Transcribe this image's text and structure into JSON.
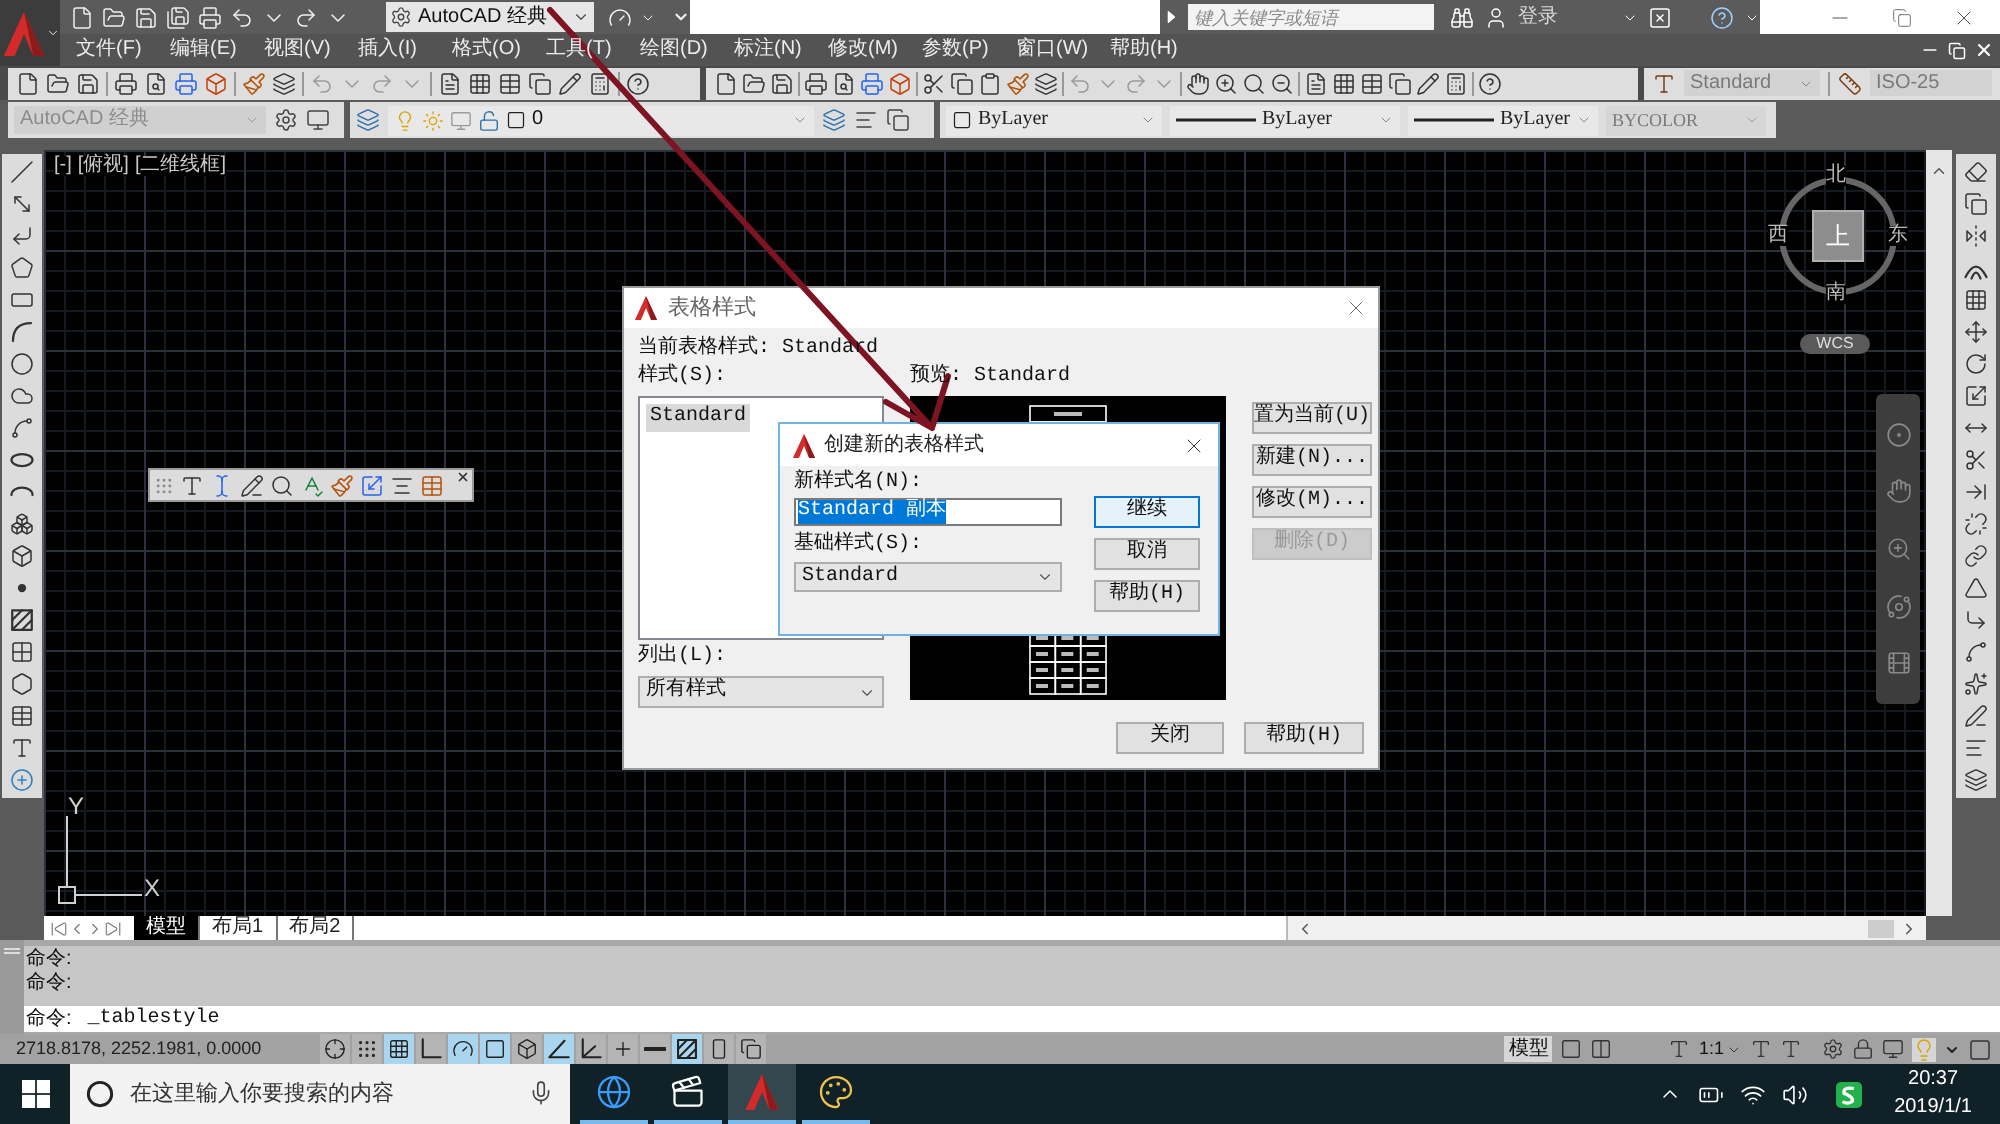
{
  "title_bar": {
    "workspace": "AutoCAD 经典",
    "search": {
      "placeholder": "键入关键字或短语"
    },
    "sign_in": "登录"
  },
  "menu_bar": {
    "items": [
      "文件(F)",
      "编辑(E)",
      "视图(V)",
      "插入(I)",
      "格式(O)",
      "工具(T)",
      "绘图(D)",
      "标注(N)",
      "修改(M)",
      "参数(P)",
      "窗口(W)",
      "帮助(H)"
    ]
  },
  "styles_toolbar": {
    "text_style": "Standard",
    "dimension_style": "ISO-25"
  },
  "properties_toolbar": {
    "workspace": "AutoCAD 经典",
    "layer": "0",
    "swatch_setting": "ByLayer",
    "linetype": "ByLayer",
    "lineweight": "ByLayer",
    "plot_style": "BYCOLOR"
  },
  "viewport": {
    "controls": [
      "[-]",
      "[俯视]",
      "[二维线框]"
    ]
  },
  "viewcube": {
    "north": "北",
    "west": "西",
    "top": "上",
    "east": "东",
    "south": "南",
    "ucs": "WCS"
  },
  "ucs_icon": {
    "y_label": "Y",
    "x_label": "X"
  },
  "table_style_dialog": {
    "title": "表格样式",
    "current_style": "当前表格样式: Standard",
    "styles_label": "样式(S):",
    "styles": [
      {
        "name": "Standard",
        "selected": true
      }
    ],
    "preview_label": "预览: Standard",
    "buttons": [
      {
        "label": "置为当前(U)",
        "disabled": false
      },
      {
        "label": "新建(N)...",
        "disabled": false
      },
      {
        "label": "修改(M)...",
        "disabled": false
      },
      {
        "label": "删除(D)",
        "disabled": true
      }
    ],
    "list_label": "列出(L):",
    "list_value": "所有样式",
    "footer_buttons": [
      "关闭",
      "帮助(H)"
    ]
  },
  "new_style_dialog": {
    "title": "创建新的表格样式",
    "name_label": "新样式名(N):",
    "name_value": "Standard 副本",
    "name_value_selected": true,
    "base_label": "基础样式(S):",
    "base_value": "Standard",
    "buttons": [
      {
        "label": "继续",
        "default": true
      },
      {
        "label": "取消",
        "default": false
      },
      {
        "label": "帮助(H)",
        "default": false
      }
    ]
  },
  "layout_tabs": [
    {
      "label": "模型",
      "selected": true
    },
    {
      "label": "布局1",
      "selected": false
    },
    {
      "label": "布局2",
      "selected": false
    }
  ],
  "command_line": {
    "history": [
      "命令:",
      "命令:"
    ],
    "prompt": "命令:",
    "input": "_tablestyle"
  },
  "status_bar": {
    "coordinates": "2718.8178, 2252.1981, 0.0000",
    "toggles": [
      {
        "kind": "infer",
        "on": false
      },
      {
        "kind": "snap",
        "on": false
      },
      {
        "kind": "grid",
        "on": true
      },
      {
        "kind": "ortho",
        "on": false
      },
      {
        "kind": "polar",
        "on": true
      },
      {
        "kind": "osnap",
        "on": true
      },
      {
        "kind": "osnap3d",
        "on": false
      },
      {
        "kind": "otrack",
        "on": true
      },
      {
        "kind": "ducs",
        "on": false
      },
      {
        "kind": "dyn",
        "on": false
      },
      {
        "kind": "lwt",
        "on": false
      },
      {
        "kind": "tpy",
        "on": true
      },
      {
        "kind": "qp",
        "on": false
      },
      {
        "kind": "sc",
        "on": false
      }
    ],
    "space": "模型",
    "annotation_scale": "1:1"
  },
  "taskbar": {
    "search": {
      "placeholder": "在这里输入你要搜索的内容"
    },
    "apps": [
      {
        "kind": "browser",
        "active": false
      },
      {
        "kind": "video",
        "active": false
      },
      {
        "kind": "cad",
        "active": true
      },
      {
        "kind": "paint",
        "active": false
      }
    ],
    "time": "20:37",
    "date": "2019/1/1"
  }
}
